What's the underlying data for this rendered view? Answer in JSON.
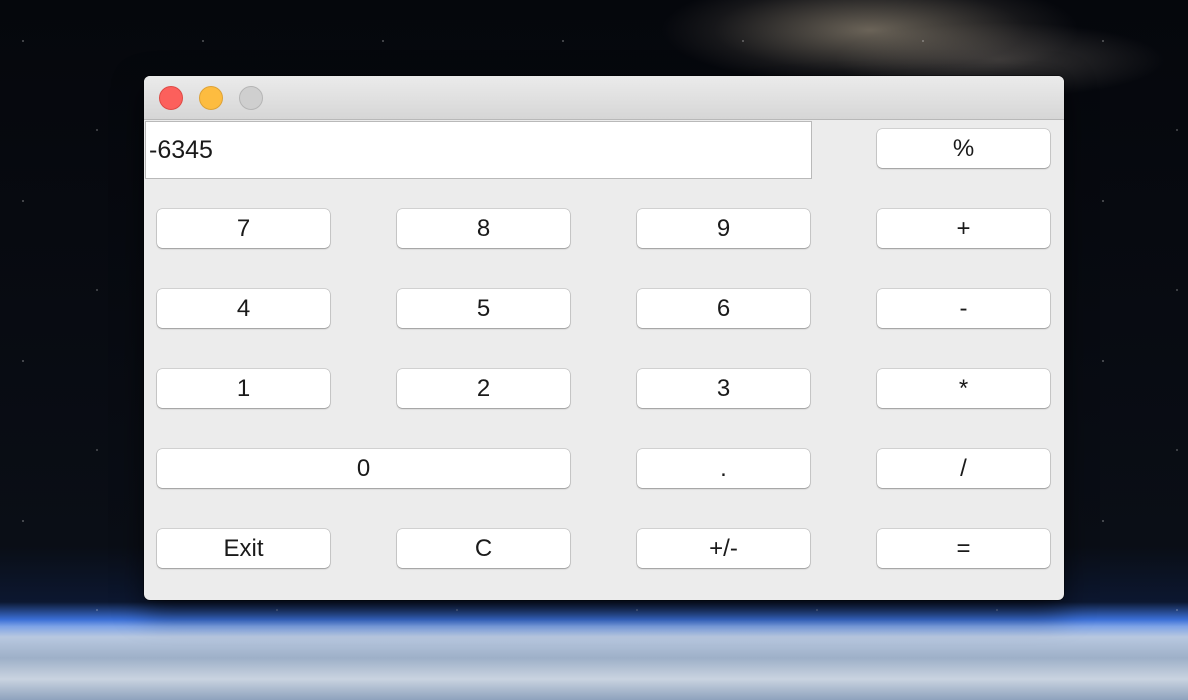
{
  "display": {
    "value": "-6345"
  },
  "buttons": {
    "percent": "%",
    "seven": "7",
    "eight": "8",
    "nine": "9",
    "plus": "+",
    "four": "4",
    "five": "5",
    "six": "6",
    "minus": "-",
    "one": "1",
    "two": "2",
    "three": "3",
    "multiply": "*",
    "zero": "0",
    "decimal": ".",
    "divide": "/",
    "exit": "Exit",
    "clear": "C",
    "negate": "+/-",
    "equals": "="
  },
  "window_controls": {
    "close_color": "#fc605c",
    "minimize_color": "#fdbc40",
    "zoom_color": "#cfcfcf"
  }
}
